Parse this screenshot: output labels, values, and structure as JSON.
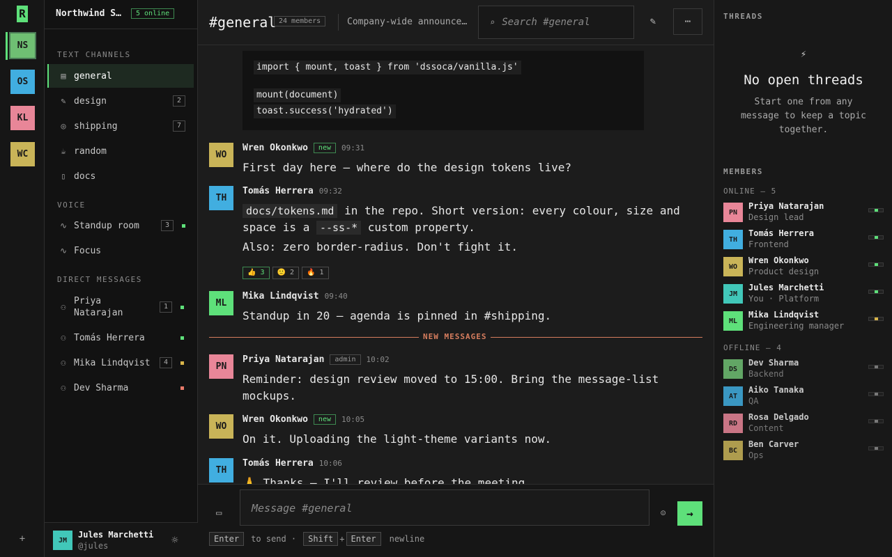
{
  "rail": {
    "logo": "R",
    "servers": [
      {
        "abbr": "NS",
        "color": "#6fbf73",
        "active": true
      },
      {
        "abbr": "OS",
        "color": "#41aee0"
      },
      {
        "abbr": "KL",
        "color": "#e88698"
      },
      {
        "abbr": "WC",
        "color": "#c9b458"
      }
    ],
    "add_label": "+"
  },
  "sidebar": {
    "workspace": "Northwind Studio",
    "online_badge": "5 online",
    "text_heading": "TEXT CHANNELS",
    "channels": [
      {
        "label": "general",
        "icon": "hash-icon",
        "glyph": "▤",
        "active": true
      },
      {
        "label": "design",
        "icon": "pen-icon",
        "glyph": "✎",
        "count": "2"
      },
      {
        "label": "shipping",
        "icon": "target-icon",
        "glyph": "◎",
        "count": "7"
      },
      {
        "label": "random",
        "icon": "coffee-icon",
        "glyph": "☕"
      },
      {
        "label": "docs",
        "icon": "doc-icon",
        "glyph": "▯"
      }
    ],
    "voice_heading": "VOICE",
    "voice": [
      {
        "label": "Standup room",
        "icon": "pulse-icon",
        "glyph": "∿",
        "count": "3",
        "dot": "#5ee07a"
      },
      {
        "label": "Focus",
        "icon": "pulse-icon",
        "glyph": "∿"
      }
    ],
    "dm_heading": "DIRECT MESSAGES",
    "dms": [
      {
        "label": "Priya\nNatarajan",
        "count": "1",
        "dot": "#5ee07a"
      },
      {
        "label": "Tomás Herrera",
        "dot": "#5ee07a"
      },
      {
        "label": "Mika Lindqvist",
        "count": "4",
        "dot": "#d9b54a"
      },
      {
        "label": "Dev Sharma",
        "dot": "#e87a6a"
      }
    ],
    "me": {
      "avatar": "JM",
      "name": "Jules Marchetti",
      "handle": "@jules",
      "color": "#41c7b9"
    }
  },
  "header": {
    "title": "#general",
    "members": "24 members",
    "topic": "Company-wide announcements",
    "search_placeholder": "Search #general",
    "search_icon": "⌕",
    "pin_icon": "✎",
    "more_icon": "⋯"
  },
  "code_lines": [
    "import { mount, toast } from 'dssoca/vanilla.js'",
    "mount(document)",
    "toast.success('hydrated')"
  ],
  "messages": [
    {
      "avatar": "WO",
      "color": "#c9b458",
      "author": "Wren Okonkwo",
      "tag": "new",
      "time": "09:31",
      "text": "First day here — where do the design tokens live?"
    },
    {
      "avatar": "TH",
      "color": "#41aee0",
      "author": "Tomás Herrera",
      "time": "09:32",
      "code1": "docs/tokens.md",
      "t1": " in the repo. Short version: every colour, size and space is a ",
      "code2": "--ss-*",
      "t2": " custom property.",
      "line2": "Also: zero border-radius. Don't fight it.",
      "reactions": [
        {
          "label": "👍 3",
          "mine": true
        },
        {
          "label": "🙂 2"
        },
        {
          "label": "🔥 1"
        }
      ]
    },
    {
      "avatar": "ML",
      "color": "#5ee07a",
      "author": "Mika Lindqvist",
      "time": "09:40",
      "text": "Standup in 20 — agenda is pinned in #shipping."
    },
    {
      "avatar": "PN",
      "color": "#e88698",
      "author": "Priya Natarajan",
      "tag": "admin",
      "time": "10:02",
      "text": "Reminder: design review moved to 15:00. Bring the message-list mockups."
    },
    {
      "avatar": "WO",
      "color": "#c9b458",
      "author": "Wren Okonkwo",
      "tag": "new",
      "time": "10:05",
      "text": "On it. Uploading the light-theme variants now."
    },
    {
      "avatar": "TH",
      "color": "#41aee0",
      "author": "Tomás Herrera",
      "time": "10:06",
      "text": "🙏 Thanks — I'll review before the meeting."
    }
  ],
  "divider": "NEW MESSAGES",
  "composer": {
    "placeholder": "Message #general",
    "attach_icon": "▭",
    "emoji_icon": "☺",
    "send_icon": "→",
    "k_enter": "Enter",
    "to_send": "to send ·",
    "k_shift": "Shift",
    "plus": "+",
    "k_enter2": "Enter",
    "newline": "newline"
  },
  "right": {
    "threads_heading": "THREADS",
    "no_threads_icon": "⚡",
    "no_threads_title": "No open threads",
    "no_threads_desc": "Start one from any message to keep a topic together.",
    "members_heading": "MEMBERS",
    "online_heading": "ONLINE — 5",
    "online": [
      {
        "avatar": "PN",
        "color": "#e88698",
        "name": "Priya Natarajan",
        "role": "Design lead",
        "status": "#5ee07a"
      },
      {
        "avatar": "TH",
        "color": "#41aee0",
        "name": "Tomás Herrera",
        "role": "Frontend",
        "status": "#5ee07a"
      },
      {
        "avatar": "WO",
        "color": "#c9b458",
        "name": "Wren Okonkwo",
        "role": "Product design",
        "status": "#5ee07a"
      },
      {
        "avatar": "JM",
        "color": "#41c7b9",
        "name": "Jules Marchetti",
        "role": "You · Platform",
        "status": "#5ee07a"
      },
      {
        "avatar": "ML",
        "color": "#5ee07a",
        "name": "Mika Lindqvist",
        "role": "Engineering manager",
        "status": "#d9b54a"
      }
    ],
    "offline_heading": "OFFLINE — 4",
    "offline": [
      {
        "avatar": "DS",
        "color": "#6fbf73",
        "name": "Dev Sharma",
        "role": "Backend",
        "status": "#8a8a8a"
      },
      {
        "avatar": "AT",
        "color": "#41aee0",
        "name": "Aiko Tanaka",
        "role": "QA",
        "status": "#8a8a8a"
      },
      {
        "avatar": "RD",
        "color": "#e88698",
        "name": "Rosa Delgado",
        "role": "Content",
        "status": "#8a8a8a"
      },
      {
        "avatar": "BC",
        "color": "#c9b458",
        "name": "Ben Carver",
        "role": "Ops",
        "status": "#8a8a8a"
      }
    ]
  }
}
